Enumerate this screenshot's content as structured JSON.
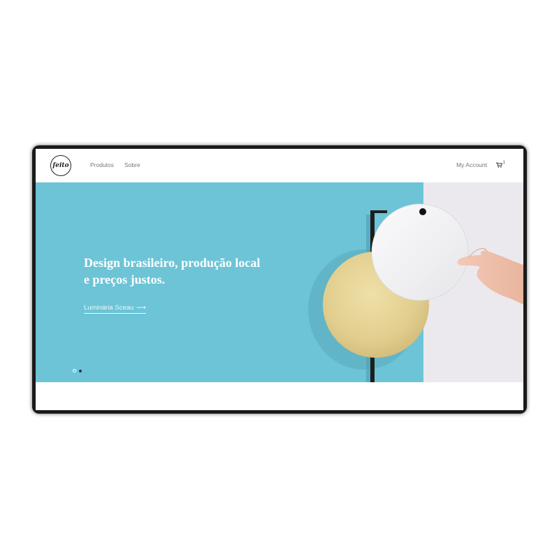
{
  "brand": {
    "logo_text": "feito"
  },
  "nav": {
    "items": [
      {
        "label": "Produtos"
      },
      {
        "label": "Sobre"
      }
    ],
    "account_label": "My Account",
    "cart_icon": "cart-icon",
    "cart_count": "1"
  },
  "hero": {
    "headline_line1": "Design brasileiro, produção local",
    "headline_line2": "e preços justos.",
    "cta_label": "Luminária Sceau",
    "cta_arrow": "⟶",
    "slides_total": 2,
    "active_slide": 1
  },
  "colors": {
    "hero_background": "#6cc4d6",
    "side_panel": "#ebe9ee",
    "brass_disc": "#e2cf8f",
    "white_disc": "#f4f4f6",
    "lamp_stand": "#1e1e1e"
  }
}
